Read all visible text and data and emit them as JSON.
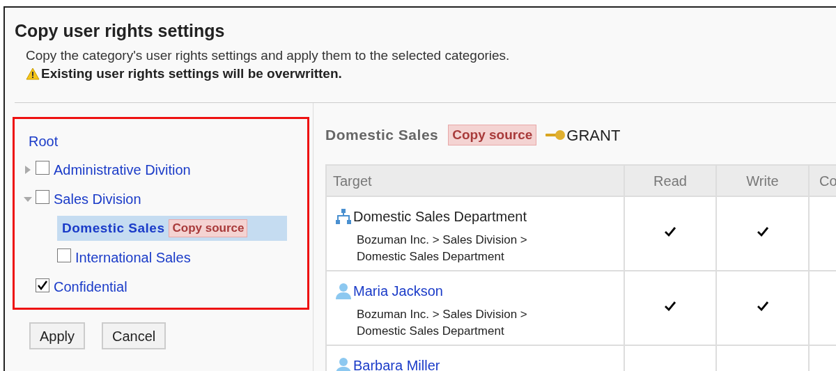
{
  "dialog": {
    "title": "Copy user rights settings",
    "description": "Copy the category's user rights settings and apply them to the selected categories.",
    "warning": "Existing user rights settings will be overwritten."
  },
  "tree": {
    "root": "Root",
    "items": [
      {
        "label": "Administrative Divition",
        "expanded": false,
        "checked": false,
        "selected": false
      },
      {
        "label": "Sales Division",
        "expanded": true,
        "checked": false,
        "selected": false,
        "children": [
          {
            "label": "Domestic Sales",
            "selected": true,
            "badge": "Copy source"
          },
          {
            "label": "International Sales",
            "checked": false,
            "selected": false
          }
        ]
      },
      {
        "label": "Confidential",
        "checked": true,
        "selected": false
      }
    ]
  },
  "buttons": [
    "Apply",
    "Cancel"
  ],
  "detail": {
    "title": "Domestic Sales",
    "badge": "Copy source",
    "grant": "GRANT",
    "table": {
      "columns": [
        "Target",
        "Read",
        "Write",
        "Co"
      ],
      "rows": [
        {
          "kind": "department",
          "name": "Domestic Sales Department",
          "path": "Bozuman Inc. > Sales Division >",
          "path_2": "Domestic Sales Department",
          "read": true,
          "write": true
        },
        {
          "kind": "user",
          "name": "Maria Jackson",
          "path": "Bozuman Inc. > Sales Division >",
          "path_2": "Domestic Sales Department",
          "read": true,
          "write": true
        },
        {
          "kind": "user",
          "name": "Barbara Miller"
        }
      ]
    }
  }
}
